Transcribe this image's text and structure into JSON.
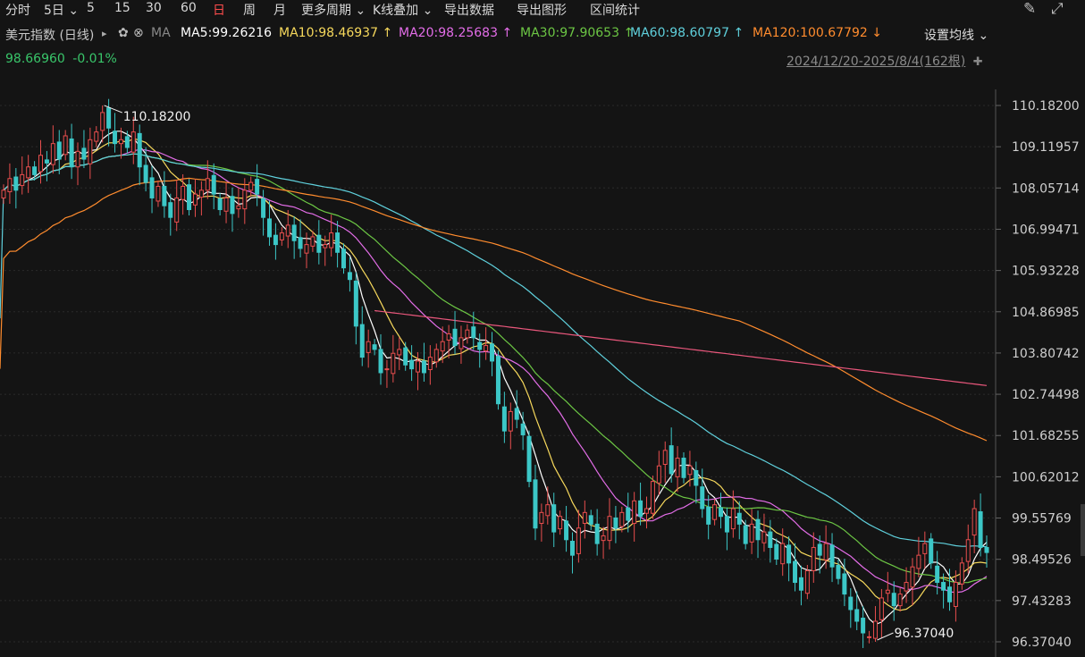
{
  "toolbar": {
    "periods": [
      {
        "label": "分时",
        "active": false
      },
      {
        "label": "5日 ⌄",
        "active": false
      },
      {
        "label": "5",
        "active": false
      },
      {
        "label": "15",
        "active": false
      },
      {
        "label": "30",
        "active": false
      },
      {
        "label": "60",
        "active": false
      },
      {
        "label": "日",
        "active": true
      },
      {
        "label": "周",
        "active": false
      },
      {
        "label": "月",
        "active": false
      },
      {
        "label": "更多周期 ⌄",
        "active": false
      },
      {
        "label": "K线叠加 ⌄",
        "active": false
      },
      {
        "label": "导出数据",
        "active": false
      },
      {
        "label": "导出图形",
        "active": false
      },
      {
        "label": "区间统计",
        "active": false
      }
    ],
    "icons": [
      "brush-icon",
      "expand-icon"
    ]
  },
  "legend": {
    "symbol": "美元指数 (日线)",
    "play_glyph": "▸",
    "gear_glyph": "✿",
    "close_glyph": "⊗",
    "ma_label": "MA",
    "ma_items": [
      {
        "label": "MA5:99.26216",
        "arrow": "",
        "color": "#ffffff"
      },
      {
        "label": "MA10:98.46937",
        "arrow": "↑",
        "color": "#f6d85c"
      },
      {
        "label": "MA20:98.25683",
        "arrow": "↑",
        "color": "#e36de8"
      },
      {
        "label": "MA30:97.90653",
        "arrow": "↑",
        "color": "#6cc644"
      },
      {
        "label": "MA60:98.60797",
        "arrow": "↑",
        "color": "#5fd0dc"
      },
      {
        "label": "MA120:100.67792",
        "arrow": "↓",
        "color": "#ff8c2e"
      }
    ],
    "settings_label": "设置均线 ⌄",
    "price": "98.66960",
    "change": "-0.01%",
    "range": "2024/12/20-2025/8/4(162根)",
    "pin_glyph": "📌"
  },
  "chart_data": {
    "type": "candlestick",
    "title": "美元指数 (日线)",
    "date_range": "2024/12/20-2025/8/4",
    "bar_count": 162,
    "y_ticks": [
      "110.18200",
      "109.11957",
      "108.05714",
      "106.99471",
      "105.93228",
      "104.86985",
      "103.80742",
      "102.74498",
      "101.68255",
      "100.62012",
      "99.55769",
      "98.49526",
      "97.43283",
      "96.37040"
    ],
    "ylim": [
      96.3704,
      110.182
    ],
    "high_label": "110.18200",
    "low_label": "96.37040",
    "colors": {
      "up": "#e94e4e",
      "down": "#3cc7c7",
      "grid": "#2a2a2a"
    },
    "close": [
      108.0,
      108.3,
      108.0,
      108.4,
      108.6,
      108.4,
      108.9,
      108.7,
      109.2,
      108.8,
      109.4,
      108.6,
      109.0,
      108.8,
      109.3,
      109.5,
      110.0,
      109.6,
      109.2,
      109.3,
      109.1,
      109.5,
      108.6,
      108.2,
      107.8,
      108.1,
      107.6,
      107.3,
      107.8,
      108.1,
      107.5,
      107.9,
      108.0,
      108.3,
      107.9,
      107.5,
      107.8,
      107.4,
      107.6,
      108.0,
      108.2,
      107.9,
      107.3,
      106.8,
      106.6,
      106.9,
      107.1,
      106.7,
      106.5,
      106.6,
      106.8,
      106.4,
      106.6,
      106.9,
      106.4,
      106.0,
      105.7,
      104.5,
      103.7,
      104.1,
      103.9,
      103.3,
      103.4,
      103.8,
      103.9,
      103.5,
      103.4,
      103.6,
      103.3,
      103.7,
      103.9,
      104.1,
      104.3,
      104.0,
      104.2,
      104.4,
      104.2,
      103.9,
      104.0,
      103.6,
      102.5,
      101.8,
      102.3,
      102.1,
      101.7,
      100.5,
      99.3,
      99.7,
      99.9,
      99.2,
      99.6,
      99.0,
      98.6,
      99.3,
      99.7,
      99.4,
      98.9,
      99.1,
      99.6,
      99.3,
      99.7,
      99.5,
      100.0,
      99.6,
      99.8,
      100.5,
      100.9,
      101.3,
      100.7,
      101.1,
      100.6,
      100.9,
      100.4,
      99.8,
      99.4,
      99.9,
      99.6,
      99.2,
      99.8,
      99.4,
      98.9,
      99.4,
      99.0,
      99.2,
      98.8,
      98.5,
      98.9,
      98.4,
      97.9,
      97.7,
      98.2,
      98.8,
      98.6,
      98.9,
      98.3,
      98.0,
      97.6,
      97.2,
      96.9,
      96.6,
      96.5,
      96.9,
      97.5,
      97.7,
      97.3,
      97.6,
      97.9,
      98.3,
      98.6,
      98.9,
      98.4,
      97.9,
      97.7,
      97.4,
      97.9,
      98.4,
      99.0,
      99.8,
      98.8,
      98.67
    ],
    "series": [
      {
        "name": "MA5",
        "color": "#ffffff"
      },
      {
        "name": "MA10",
        "color": "#f6d85c"
      },
      {
        "name": "MA20",
        "color": "#e36de8"
      },
      {
        "name": "MA30",
        "color": "#6cc644"
      },
      {
        "name": "MA60",
        "color": "#5fd0dc"
      },
      {
        "name": "MA120",
        "color": "#ff8c2e"
      },
      {
        "name": "MA250",
        "color": "#e9577c",
        "start_index": 60
      }
    ]
  }
}
